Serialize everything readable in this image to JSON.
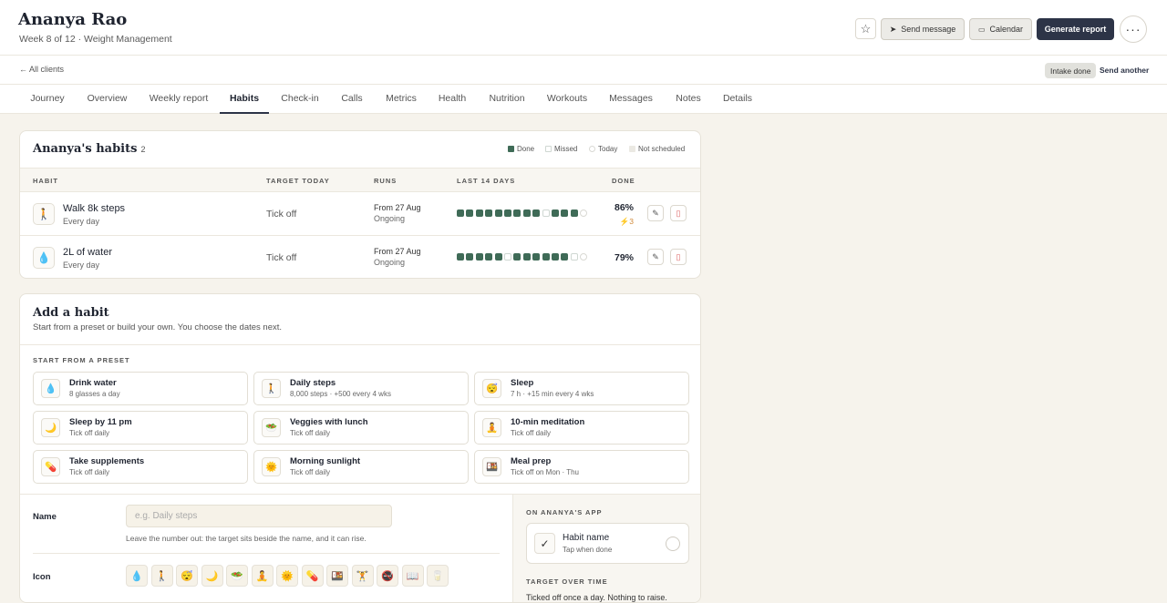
{
  "client": {
    "name": "Ananya Rao",
    "subtitle": "Week 8 of 12 · Weight Management"
  },
  "header": {
    "star_icon": "star-icon",
    "send_message": "Send message",
    "calendar": "Calendar",
    "generate_report": "Generate report",
    "more": "···"
  },
  "subnav": {
    "back": "← All clients",
    "intake_badge": "Intake done",
    "send_another": "Send another"
  },
  "tabs": [
    {
      "label": "Journey"
    },
    {
      "label": "Overview"
    },
    {
      "label": "Weekly report"
    },
    {
      "label": "Habits",
      "active": true
    },
    {
      "label": "Check-in"
    },
    {
      "label": "Calls"
    },
    {
      "label": "Metrics"
    },
    {
      "label": "Health"
    },
    {
      "label": "Nutrition"
    },
    {
      "label": "Workouts"
    },
    {
      "label": "Messages"
    },
    {
      "label": "Notes"
    },
    {
      "label": "Details"
    }
  ],
  "habits_card": {
    "title": "Ananya's habits",
    "count": "2",
    "legend": [
      {
        "label": "Done",
        "color": "#3f6b57"
      },
      {
        "label": "Missed",
        "color": "#ffffff"
      },
      {
        "label": "Today",
        "color": "#ffffff"
      },
      {
        "label": "Not scheduled",
        "color": "#ebe9e3"
      }
    ],
    "columns": [
      "HABIT",
      "TARGET TODAY",
      "RUNS",
      "LAST 14 DAYS",
      "DONE"
    ],
    "rows": [
      {
        "icon": "🚶",
        "name": "Walk 8k steps",
        "frequency": "Every day",
        "target": "Tick off",
        "runs_from": "From 27 Aug",
        "runs_status": "Ongoing",
        "days": [
          "done",
          "done",
          "done",
          "done",
          "done",
          "done",
          "done",
          "done",
          "done",
          "missed",
          "done",
          "done",
          "done",
          "today"
        ],
        "done_pct": "86%",
        "streak": "⚡3"
      },
      {
        "icon": "💧",
        "name": "2L of water",
        "frequency": "Every day",
        "target": "Tick off",
        "runs_from": "From 27 Aug",
        "runs_status": "Ongoing",
        "days": [
          "done",
          "done",
          "done",
          "done",
          "done",
          "missed",
          "done",
          "done",
          "done",
          "done",
          "done",
          "done",
          "missed",
          "today"
        ],
        "done_pct": "79%",
        "streak": ""
      }
    ]
  },
  "add_card": {
    "title": "Add a habit",
    "subtitle": "Start from a preset or build your own. You choose the dates next.",
    "preset_label": "START FROM A PRESET",
    "presets": [
      {
        "icon": "💧",
        "title": "Drink water",
        "sub": "8 glasses a day"
      },
      {
        "icon": "🚶",
        "title": "Daily steps",
        "sub": "8,000 steps · +500 every 4 wks"
      },
      {
        "icon": "😴",
        "title": "Sleep",
        "sub": "7 h · +15 min every 4 wks"
      },
      {
        "icon": "🌙",
        "title": "Sleep by 11 pm",
        "sub": "Tick off daily"
      },
      {
        "icon": "🥗",
        "title": "Veggies with lunch",
        "sub": "Tick off daily"
      },
      {
        "icon": "🧘",
        "title": "10-min meditation",
        "sub": "Tick off daily"
      },
      {
        "icon": "💊",
        "title": "Take supplements",
        "sub": "Tick off daily"
      },
      {
        "icon": "🌞",
        "title": "Morning sunlight",
        "sub": "Tick off daily"
      },
      {
        "icon": "🍱",
        "title": "Meal prep",
        "sub": "Tick off on Mon · Thu"
      }
    ],
    "name_label": "Name",
    "name_placeholder": "e.g. Daily steps",
    "name_hint": "Leave the number out: the target sits beside the name, and it can rise.",
    "icon_label": "Icon",
    "icon_options": [
      "💧",
      "🚶",
      "😴",
      "🌙",
      "🥗",
      "🧘",
      "🌞",
      "💊",
      "🍱",
      "🏋",
      "🚭",
      "📖",
      "🥛"
    ],
    "app_label": "ON ANANYA'S APP",
    "app_preview": {
      "check": "✓",
      "name": "Habit name",
      "sub": "Tap when done"
    },
    "target_label": "TARGET OVER TIME",
    "target_text": "Ticked off once a day. Nothing to raise."
  }
}
